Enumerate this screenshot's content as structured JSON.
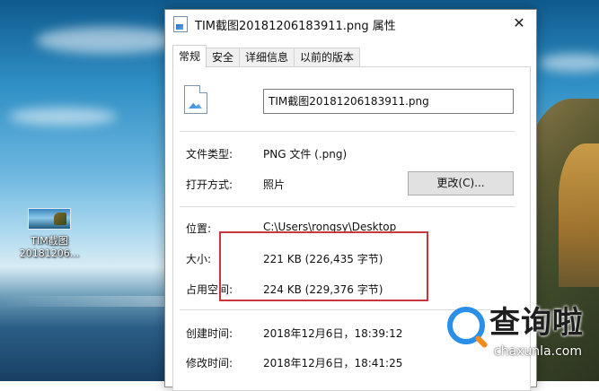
{
  "desktop": {
    "icon_label_line1": "TIM截图",
    "icon_label_line2": "20181206..."
  },
  "dialog": {
    "title": "TIM截图20181206183911.png 属性",
    "close_glyph": "✕",
    "tabs": [
      {
        "label": "常规",
        "active": true
      },
      {
        "label": "安全"
      },
      {
        "label": "详细信息"
      },
      {
        "label": "以前的版本"
      }
    ],
    "file_name": "TIM截图20181206183911.png",
    "rows": {
      "file_type_label": "文件类型:",
      "file_type_value": "PNG 文件 (.png)",
      "open_with_label": "打开方式:",
      "open_with_value": "照片",
      "change_button": "更改(C)...",
      "location_label": "位置:",
      "location_value": "C:\\Users\\rongsy\\Desktop",
      "size_label": "大小:",
      "size_value": "221 KB (226,435 字节)",
      "disk_size_label": "占用空间:",
      "disk_size_value": "224 KB (229,376 字节)",
      "created_label": "创建时间:",
      "created_value": "2018年12月6日，18:39:12",
      "modified_label": "修改时间:",
      "modified_value": "2018年12月6日，18:41:25"
    },
    "highlight_color": "#c8383a"
  },
  "watermark": {
    "text": "查询啦",
    "domain": "chaxunla.com"
  }
}
